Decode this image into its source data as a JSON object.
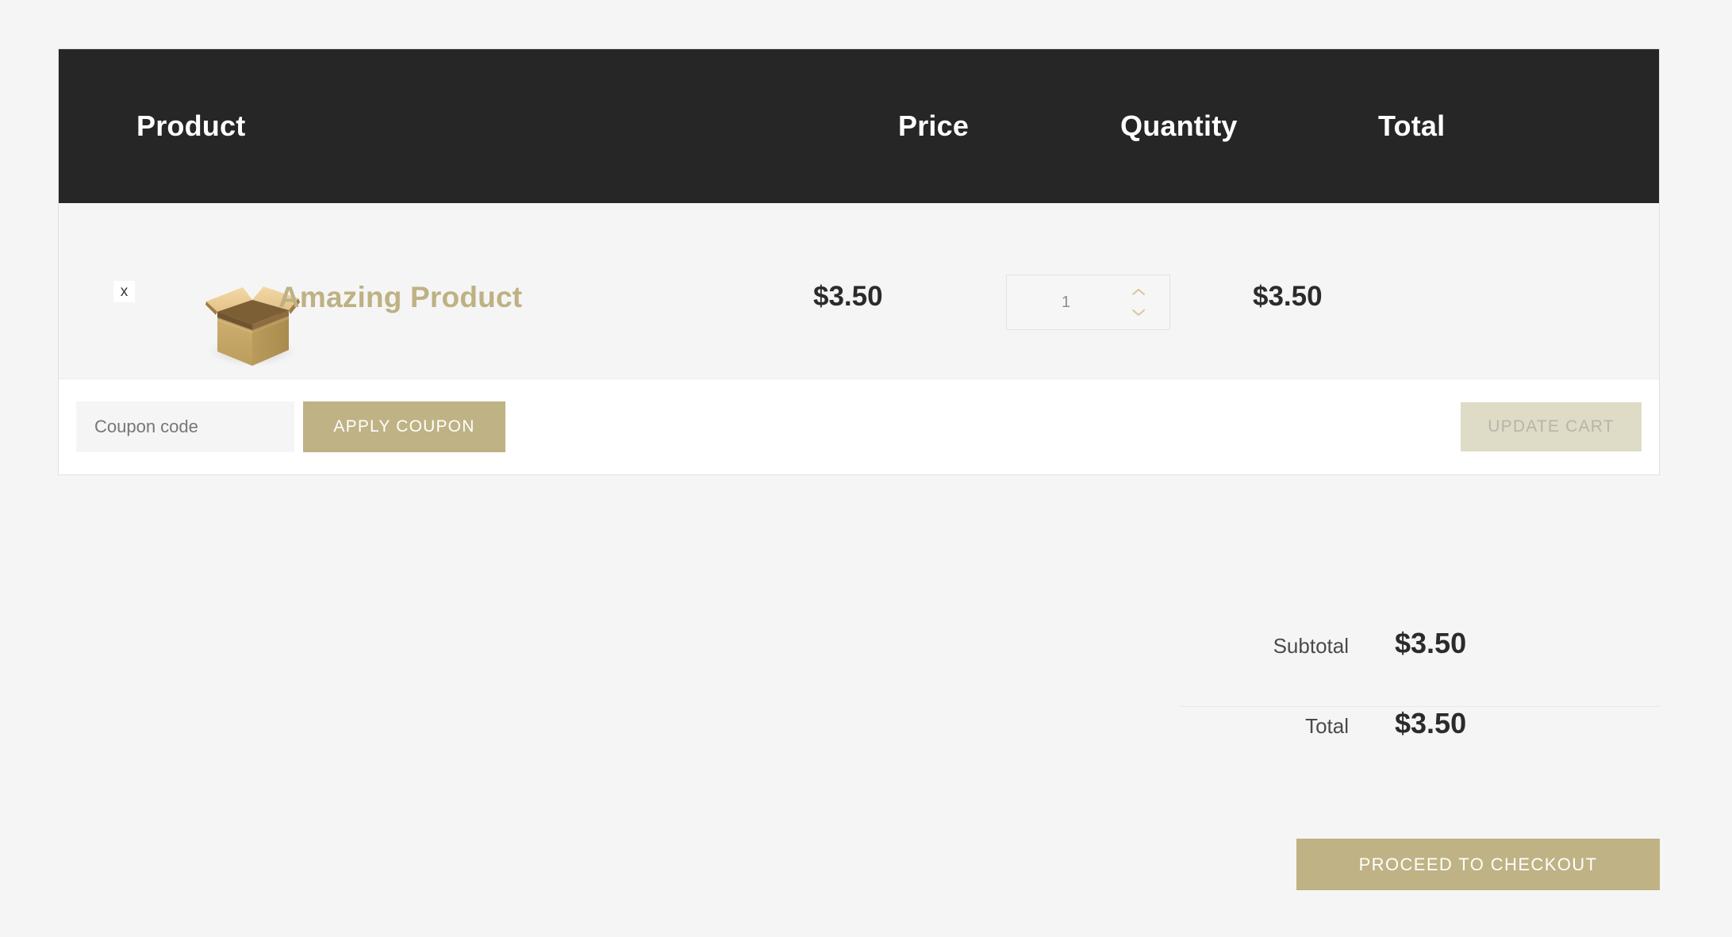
{
  "table": {
    "headers": {
      "product": "Product",
      "price": "Price",
      "quantity": "Quantity",
      "total": "Total"
    }
  },
  "cart_items": [
    {
      "remove_label": "x",
      "thumbnail": "cardboard-box-placeholder",
      "name": "Amazing Product",
      "price": "$3.50",
      "quantity": "1",
      "line_total": "$3.50"
    }
  ],
  "coupon": {
    "placeholder": "Coupon code",
    "value": "",
    "apply_label": "APPLY COUPON"
  },
  "actions": {
    "update_cart_label": "UPDATE CART",
    "checkout_label": "PROCEED TO CHECKOUT"
  },
  "totals": {
    "subtotal_label": "Subtotal",
    "subtotal_value": "$3.50",
    "total_label": "Total",
    "total_value": "$3.50"
  },
  "colors": {
    "accent": "#bfb284",
    "header_bg": "#262626",
    "page_bg": "#f5f5f5",
    "row_bg": "#f5f5f5",
    "disabled_btn": "#dedcc6",
    "product_link": "#beb183"
  }
}
